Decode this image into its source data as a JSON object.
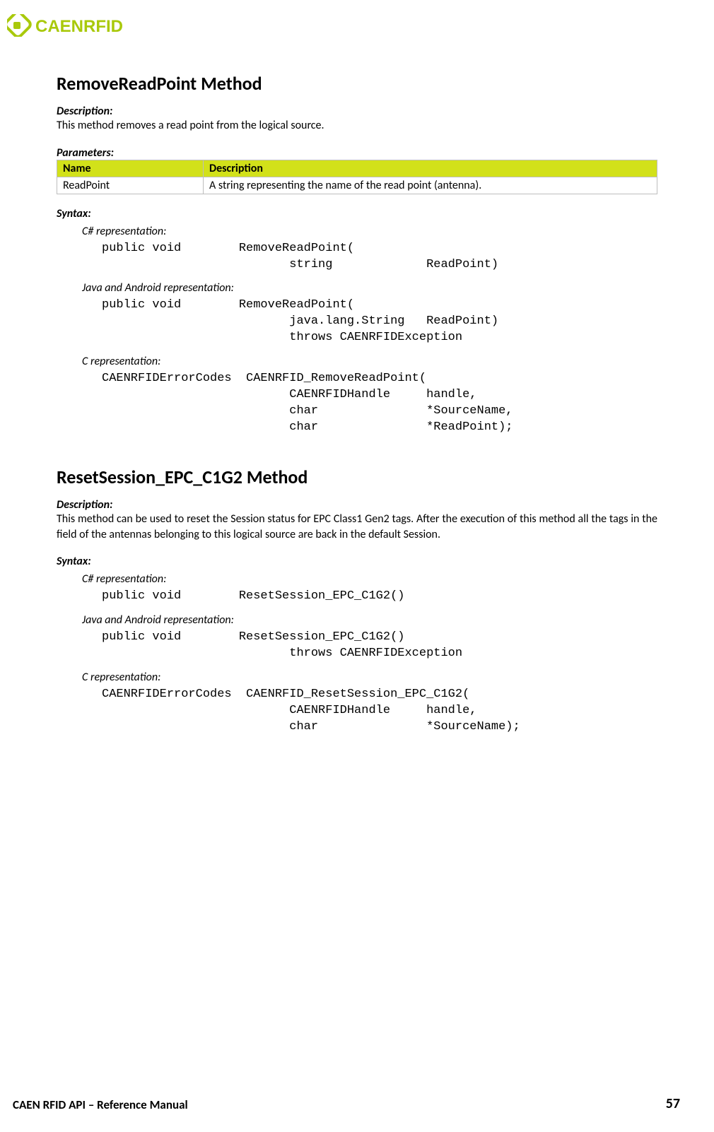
{
  "brand": {
    "name": "CAENRFID"
  },
  "section1": {
    "title": "RemoveReadPoint Method",
    "desc_label": "Description:",
    "desc_text": "This method removes a read point from the logical source.",
    "param_label": "Parameters:",
    "param_table": {
      "headers": {
        "name": "Name",
        "desc": "Description"
      },
      "rows": [
        {
          "name": "ReadPoint",
          "desc": "A string representing the name of the read point (antenna)."
        }
      ]
    },
    "syntax_label": "Syntax:",
    "csharp_label": "C# representation:",
    "csharp_code": "public void        RemoveReadPoint(\n                          string             ReadPoint)",
    "java_label": "Java and Android representation:",
    "java_code": "public void        RemoveReadPoint(\n                          java.lang.String   ReadPoint)\n                          throws CAENRFIDException",
    "c_label": "C representation:",
    "c_code": "CAENRFIDErrorCodes  CAENRFID_RemoveReadPoint(\n                          CAENRFIDHandle     handle,\n                          char               *SourceName,\n                          char               *ReadPoint);"
  },
  "section2": {
    "title": "ResetSession_EPC_C1G2 Method",
    "desc_label": "Description:",
    "desc_text": "This method can be used to reset the Session status for EPC Class1 Gen2 tags. After the execution of this method all the tags in the field of the antennas belonging to this logical source are back in the default Session.",
    "syntax_label": "Syntax:",
    "csharp_label": "C# representation:",
    "csharp_code": "public void        ResetSession_EPC_C1G2()",
    "java_label": "Java and Android representation:",
    "java_code": "public void        ResetSession_EPC_C1G2()\n                          throws CAENRFIDException",
    "c_label": "C representation:",
    "c_code": "CAENRFIDErrorCodes  CAENRFID_ResetSession_EPC_C1G2(\n                          CAENRFIDHandle     handle,\n                          char               *SourceName);"
  },
  "footer": {
    "left": "CAEN RFID API – Reference Manual",
    "page": "57"
  }
}
